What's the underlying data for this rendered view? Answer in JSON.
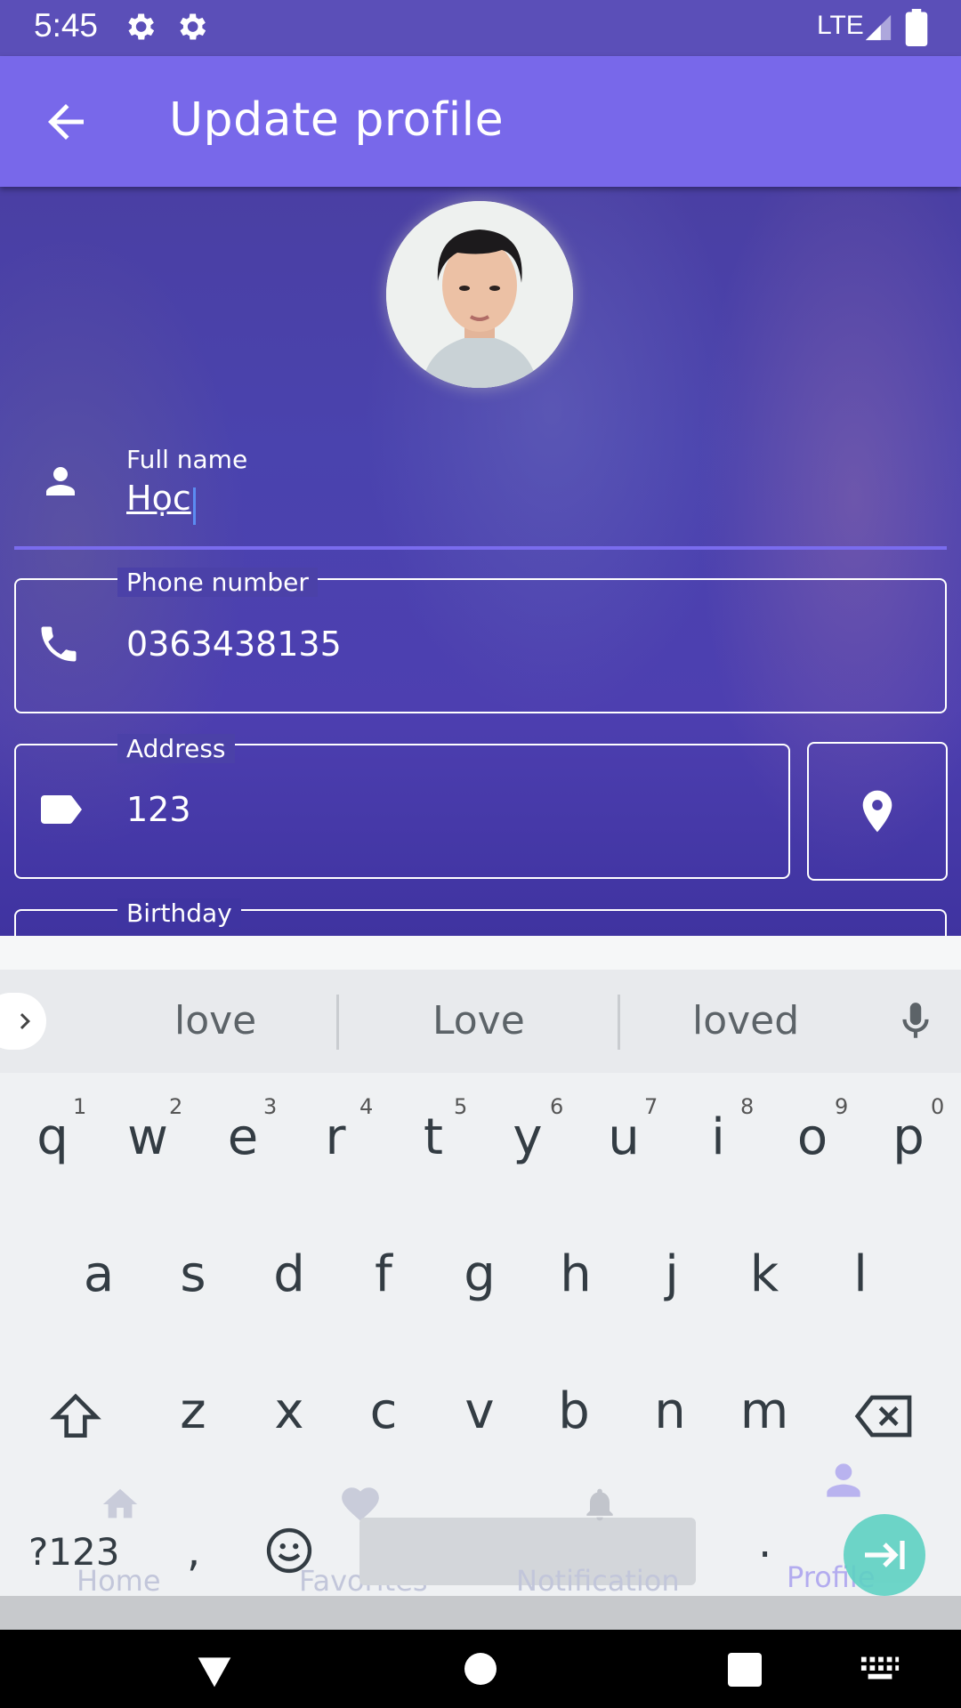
{
  "status_bar": {
    "time": "5:45",
    "network": "LTE"
  },
  "app_bar": {
    "title": "Update profile"
  },
  "form": {
    "full_name": {
      "label": "Full name",
      "value": "Học"
    },
    "phone": {
      "label": "Phone number",
      "value": "0363438135"
    },
    "address": {
      "label": "Address",
      "value": "123"
    },
    "birthday": {
      "label": "Birthday"
    }
  },
  "bottom_nav": {
    "items": [
      {
        "label": "Home",
        "icon": "home-icon"
      },
      {
        "label": "Favorites",
        "icon": "heart-icon"
      },
      {
        "label": "Notification",
        "icon": "bell-icon"
      },
      {
        "label": "Profile",
        "icon": "person-icon"
      }
    ]
  },
  "keyboard": {
    "suggestions": [
      "love",
      "Love",
      "loved"
    ],
    "row1": [
      "q",
      "w",
      "e",
      "r",
      "t",
      "y",
      "u",
      "i",
      "o",
      "p"
    ],
    "row1_numbers": [
      "1",
      "2",
      "3",
      "4",
      "5",
      "6",
      "7",
      "8",
      "9",
      "0"
    ],
    "row2": [
      "a",
      "s",
      "d",
      "f",
      "g",
      "h",
      "j",
      "k",
      "l"
    ],
    "row3": [
      "z",
      "x",
      "c",
      "v",
      "b",
      "n",
      "m"
    ],
    "symbols_key": "?123",
    "comma_key": ",",
    "period_key": "."
  },
  "colors": {
    "app_bar": "#7868ea",
    "status_bar": "#5b4fb8",
    "accent_fab": "#5ed1c3"
  }
}
